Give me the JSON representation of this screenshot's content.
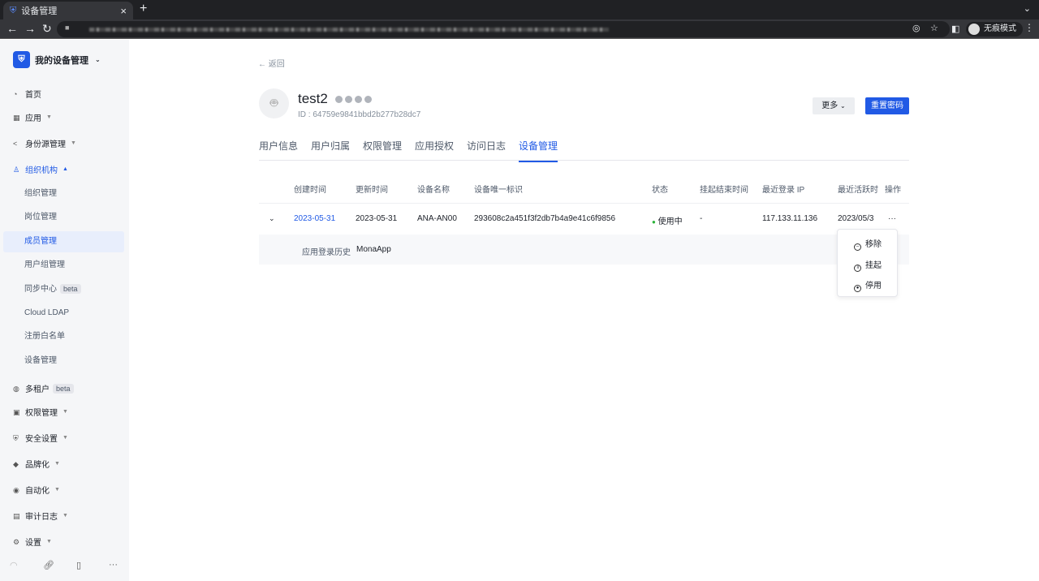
{
  "browser": {
    "tab_title": "设备管理",
    "incognito_label": "无痕模式"
  },
  "sidebar": {
    "org_name": "我的设备管理",
    "items": [
      {
        "label": "首页"
      },
      {
        "label": "应用"
      },
      {
        "label": "身份源管理"
      },
      {
        "label": "组织机构"
      },
      {
        "label": "多租户",
        "badge": "beta"
      },
      {
        "label": "权限管理"
      },
      {
        "label": "安全设置"
      },
      {
        "label": "品牌化"
      },
      {
        "label": "自动化"
      },
      {
        "label": "审计日志"
      },
      {
        "label": "设置"
      }
    ],
    "subitems": [
      {
        "label": "组织管理"
      },
      {
        "label": "岗位管理"
      },
      {
        "label": "成员管理"
      },
      {
        "label": "用户组管理"
      },
      {
        "label": "同步中心",
        "badge": "beta"
      },
      {
        "label": "Cloud LDAP"
      },
      {
        "label": "注册白名单"
      },
      {
        "label": "设备管理"
      }
    ]
  },
  "page": {
    "back": "返回",
    "username": "test2",
    "user_id": "ID : 64759e9841bbd2b277b28dc7",
    "more_label": "更多",
    "reset_label": "重置密码",
    "tabs": [
      "用户信息",
      "用户归属",
      "权限管理",
      "应用授权",
      "访问日志",
      "设备管理"
    ],
    "active_tab": "设备管理"
  },
  "table": {
    "headers": [
      "创建时间",
      "更新时间",
      "设备名称",
      "设备唯一标识",
      "状态",
      "挂起结束时间",
      "最近登录 IP",
      "最近活跃时",
      "操作"
    ],
    "row": {
      "created": "2023-05-31",
      "updated": "2023-05-31",
      "name": "ANA-AN00",
      "uid": "293608c2a451f3f2db7b4a9e41c6f9856",
      "status": "使用中",
      "suspend_end": "-",
      "ip": "117.133.11.136",
      "last_active": "2023/05/3",
      "actions": "···"
    },
    "expanded": {
      "label": "应用登录历史",
      "value": "MonaApp"
    },
    "status_color": "#2bb33a"
  },
  "action_menu": [
    "移除",
    "挂起",
    "停用"
  ],
  "colors": {
    "primary": "#215ae5"
  }
}
